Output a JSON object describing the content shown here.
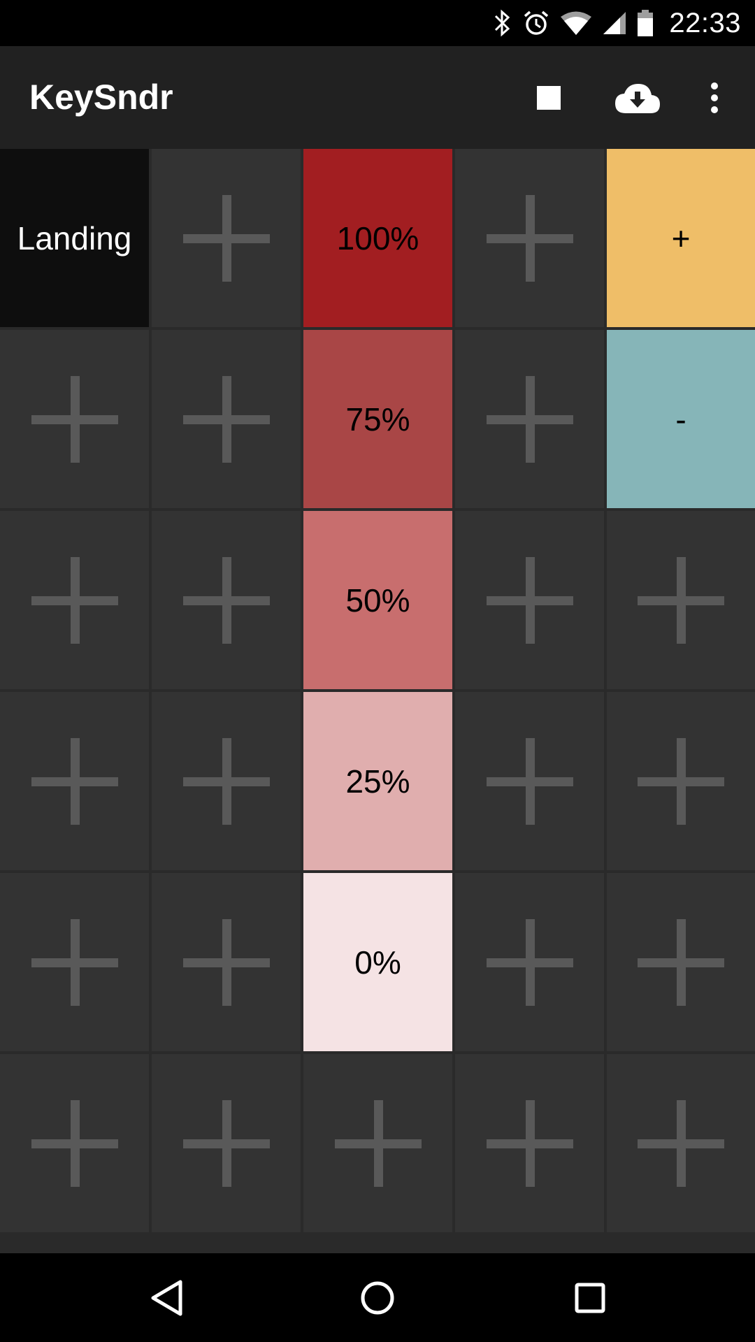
{
  "status_bar": {
    "time": "22:33",
    "icons": [
      "bluetooth-icon",
      "alarm-icon",
      "wifi-icon",
      "cellular-signal-icon",
      "battery-icon"
    ]
  },
  "app_bar": {
    "title": "KeySndr",
    "actions": [
      "stop-icon",
      "cloud-download-icon",
      "overflow-menu-icon"
    ]
  },
  "grid": {
    "columns": 5,
    "rows": 6,
    "cells": [
      {
        "label": "Landing",
        "type": "button",
        "color": "#0e0e0e",
        "text_color": "#ffffff"
      },
      {
        "label": "",
        "type": "empty"
      },
      {
        "label": "100%",
        "type": "button",
        "color": "#a21e21"
      },
      {
        "label": "",
        "type": "empty"
      },
      {
        "label": "+",
        "type": "button",
        "color": "#efbe68"
      },
      {
        "label": "",
        "type": "empty"
      },
      {
        "label": "",
        "type": "empty"
      },
      {
        "label": "75%",
        "type": "button",
        "color": "#a94646"
      },
      {
        "label": "",
        "type": "empty"
      },
      {
        "label": "-",
        "type": "button",
        "color": "#86b5b8"
      },
      {
        "label": "",
        "type": "empty"
      },
      {
        "label": "",
        "type": "empty"
      },
      {
        "label": "50%",
        "type": "button",
        "color": "#c86e6e"
      },
      {
        "label": "",
        "type": "empty"
      },
      {
        "label": "",
        "type": "empty"
      },
      {
        "label": "",
        "type": "empty"
      },
      {
        "label": "",
        "type": "empty"
      },
      {
        "label": "25%",
        "type": "button",
        "color": "#e0aeae"
      },
      {
        "label": "",
        "type": "empty"
      },
      {
        "label": "",
        "type": "empty"
      },
      {
        "label": "",
        "type": "empty"
      },
      {
        "label": "",
        "type": "empty"
      },
      {
        "label": "0%",
        "type": "button",
        "color": "#f5e3e4"
      },
      {
        "label": "",
        "type": "empty"
      },
      {
        "label": "",
        "type": "empty"
      },
      {
        "label": "",
        "type": "empty"
      },
      {
        "label": "",
        "type": "empty"
      },
      {
        "label": "",
        "type": "empty"
      },
      {
        "label": "",
        "type": "empty"
      },
      {
        "label": "",
        "type": "empty"
      }
    ]
  },
  "nav_bar": {
    "buttons": [
      "back-icon",
      "home-icon",
      "recents-icon"
    ]
  }
}
